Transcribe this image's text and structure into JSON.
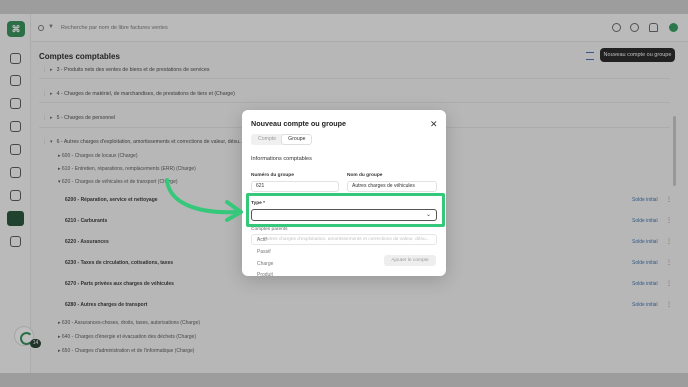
{
  "topbar": {
    "search_placeholder": "Recherche par nom de libre factures ventes"
  },
  "sidebar": {
    "notification_count": "14"
  },
  "page": {
    "title": "Comptes comptables",
    "new_button": "Nouveau compte ou groupe"
  },
  "tree": {
    "groups": [
      "3 - Produits nets des ventes de biens et de prestations de services",
      "4 - Charges de matériel, de marchandises, de prestations de tiers et (Charge)",
      "5 - Charges de personnel",
      "6 - Autres charges d'exploitation, amortissements et corrections de valeur, désu..."
    ],
    "subgroups": [
      "600 - Charges de locaux (Charge)",
      "610 - Entretien, réparations, remplacements (ERR) (Charge)",
      "620 - Charges de véhicules et de transport (Charge)"
    ],
    "accounts": [
      "6200 - Réparation, service et nettoyage",
      "6210 - Carburants",
      "6220 - Assurances",
      "6230 - Taxes de circulation, cotisations, taxes",
      "6270 - Parts privées aux charges de véhicules",
      "6280 - Autres charges de transport"
    ],
    "solde_label": "Solde initial",
    "more_subgroups": [
      "630 - Assurances-choses, droits, taxes, autorisations (Charge)",
      "640 - Charges d'énergie et évacuation des déchets (Charge)",
      "650 - Charges d'administration et de l'informatique (Charge)"
    ]
  },
  "modal": {
    "title": "Nouveau compte ou groupe",
    "tabs": [
      {
        "label": "Compte",
        "active": false
      },
      {
        "label": "Groupe",
        "active": true
      }
    ],
    "section_title": "Informations comptables",
    "number_label": "Numéro du groupe",
    "number_value": "621",
    "name_label": "Nom du groupe",
    "name_value": "Autres charges de véhicules",
    "type_label": "Type *",
    "type_value": "",
    "parents_label": "Comptes parents",
    "parents_value": "6 - Autres charges d'exploitation, amortissements et corrections de valeur, désu...",
    "add_button": "Ajouter le compte",
    "type_options": [
      "Actif",
      "Passif",
      "Charge",
      "Produit"
    ]
  },
  "colors": {
    "highlight": "#36c87a",
    "brand": "#2f8f55"
  }
}
